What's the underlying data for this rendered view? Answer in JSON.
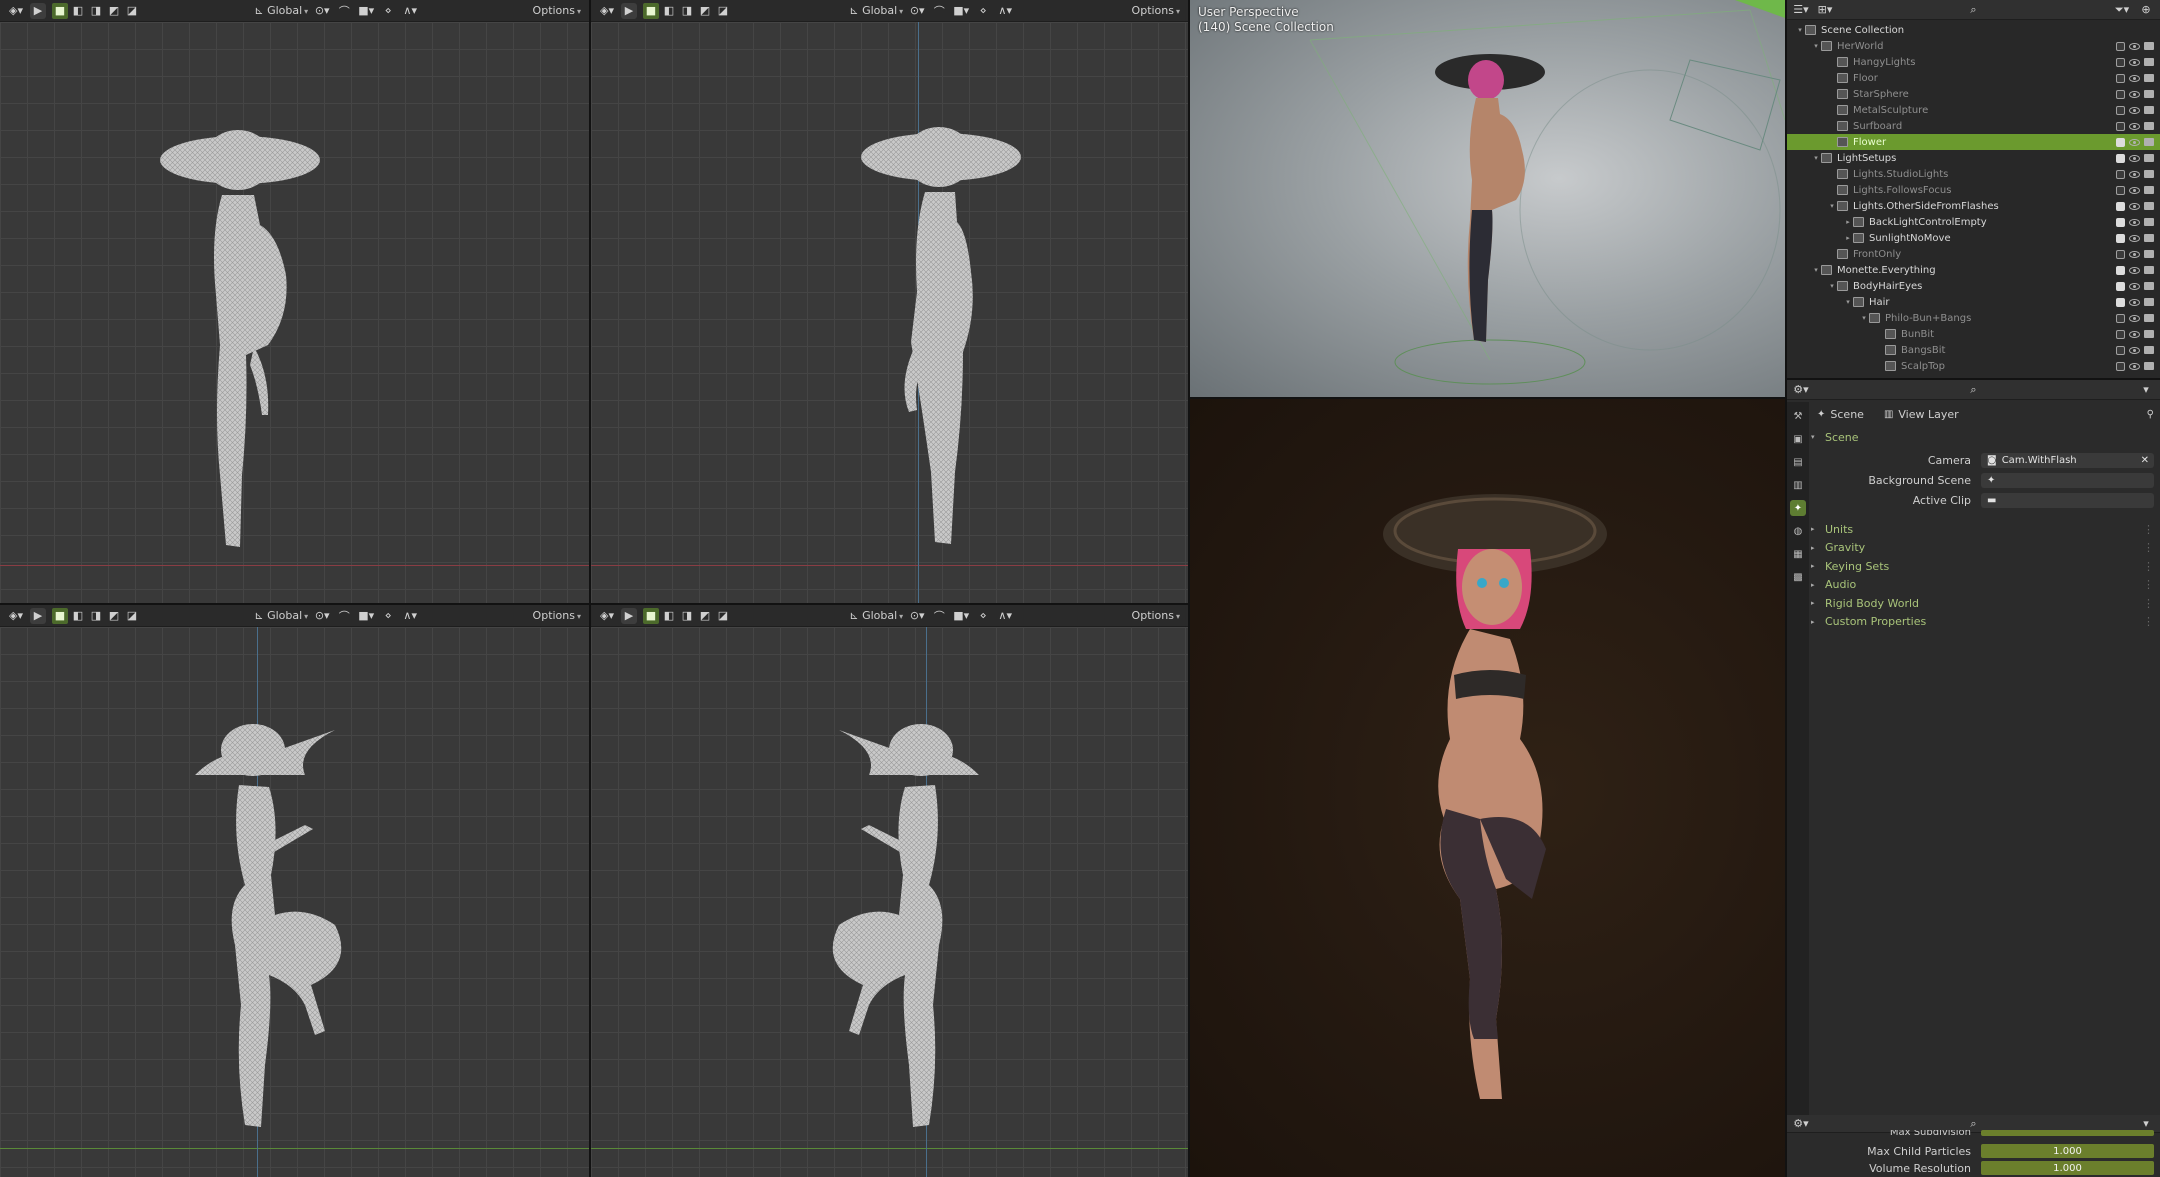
{
  "viewport_header": {
    "transform_orientation": "Global",
    "options_label": "Options"
  },
  "camera_view": {
    "title": "User Perspective",
    "subtitle": "(140) Scene Collection"
  },
  "outliner": {
    "rows": [
      {
        "label": "Scene Collection",
        "depth": 0,
        "expanded": "▾",
        "state": "on"
      },
      {
        "label": "HerWorld",
        "depth": 1,
        "expanded": "▾",
        "state": "off"
      },
      {
        "label": "HangyLights",
        "depth": 2,
        "expanded": "",
        "state": "off"
      },
      {
        "label": "Floor",
        "depth": 2,
        "expanded": "",
        "state": "off"
      },
      {
        "label": "StarSphere",
        "depth": 2,
        "expanded": "",
        "state": "off"
      },
      {
        "label": "MetalSculpture",
        "depth": 2,
        "expanded": "",
        "state": "off"
      },
      {
        "label": "Surfboard",
        "depth": 2,
        "expanded": "",
        "state": "off"
      },
      {
        "label": "Flower",
        "depth": 2,
        "expanded": "",
        "state": "selected"
      },
      {
        "label": "LightSetups",
        "depth": 1,
        "expanded": "▾",
        "state": "on"
      },
      {
        "label": "Lights.StudioLights",
        "depth": 2,
        "expanded": "",
        "state": "off"
      },
      {
        "label": "Lights.FollowsFocus",
        "depth": 2,
        "expanded": "",
        "state": "off"
      },
      {
        "label": "Lights.OtherSideFromFlashes",
        "depth": 2,
        "expanded": "▾",
        "state": "on"
      },
      {
        "label": "BackLightControlEmpty",
        "depth": 3,
        "expanded": "▸",
        "state": "on"
      },
      {
        "label": "SunlightNoMove",
        "depth": 3,
        "expanded": "▸",
        "state": "on"
      },
      {
        "label": "FrontOnly",
        "depth": 2,
        "expanded": "",
        "state": "off"
      },
      {
        "label": "Monette.Everything",
        "depth": 1,
        "expanded": "▾",
        "state": "on"
      },
      {
        "label": "BodyHairEyes",
        "depth": 2,
        "expanded": "▾",
        "state": "on"
      },
      {
        "label": "Hair",
        "depth": 3,
        "expanded": "▾",
        "state": "on"
      },
      {
        "label": "Philo-Bun+Bangs",
        "depth": 4,
        "expanded": "▾",
        "state": "off"
      },
      {
        "label": "BunBit",
        "depth": 5,
        "expanded": "",
        "state": "off"
      },
      {
        "label": "BangsBit",
        "depth": 5,
        "expanded": "",
        "state": "off"
      },
      {
        "label": "ScalpTop",
        "depth": 5,
        "expanded": "",
        "state": "off"
      }
    ]
  },
  "properties": {
    "breadcrumb_scene": "Scene",
    "breadcrumb_view_layer": "View Layer",
    "section_scene": "Scene",
    "camera_label": "Camera",
    "camera_value": "Cam.WithFlash",
    "background_scene_label": "Background Scene",
    "active_clip_label": "Active Clip",
    "sections": [
      "Units",
      "Gravity",
      "Keying Sets",
      "Audio",
      "Rigid Body World",
      "Custom Properties"
    ]
  },
  "properties2": {
    "partial_row": "Max Subdivision",
    "max_child_particles_label": "Max Child Particles",
    "max_child_particles_value": "1.000",
    "volume_resolution_label": "Volume Resolution",
    "volume_resolution_value": "1.000"
  }
}
